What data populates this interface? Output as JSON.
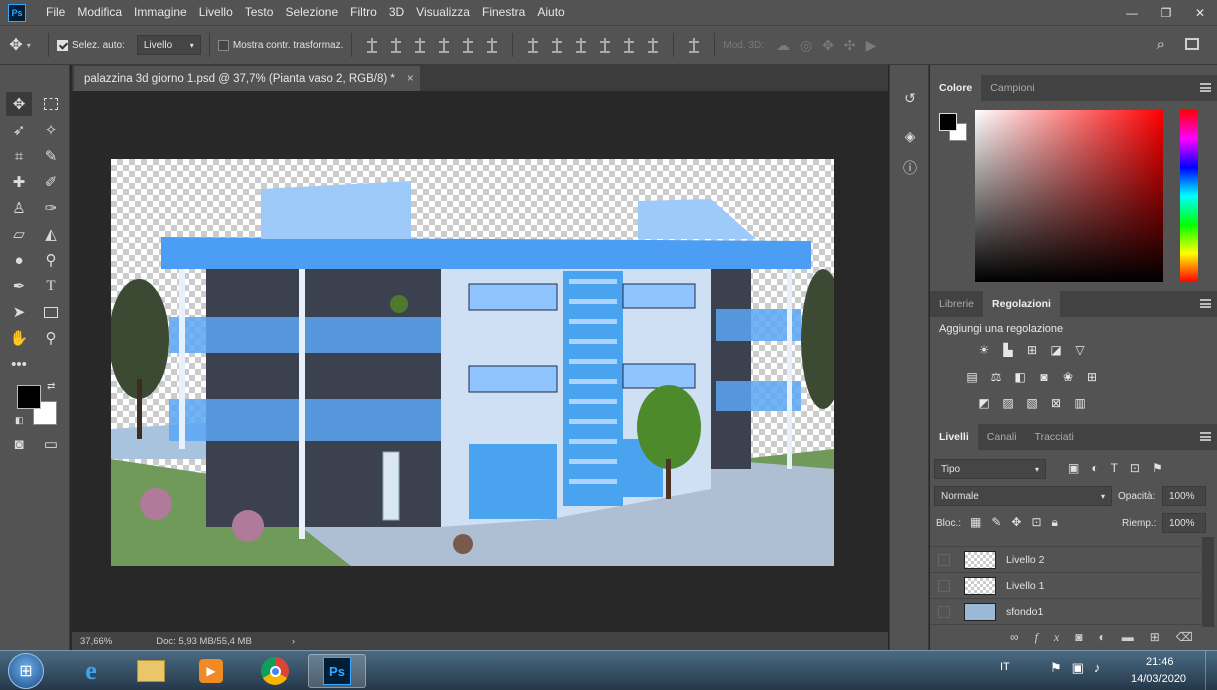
{
  "app": {
    "logo_text": "Ps",
    "menu": [
      "File",
      "Modifica",
      "Immagine",
      "Livello",
      "Testo",
      "Selezione",
      "Filtro",
      "3D",
      "Visualizza",
      "Finestra",
      "Aiuto"
    ]
  },
  "window_controls": {
    "minimize": "—",
    "restore": "❐",
    "close": "✕"
  },
  "options_bar": {
    "auto_select_label": "Selez. auto:",
    "auto_select_checked": true,
    "auto_select_value": "Livello",
    "show_transform_label": "Mostra contr. trasformaz.",
    "show_transform_checked": false,
    "mode_3d_label": "Mod. 3D:"
  },
  "document": {
    "tab_title": "palazzina 3d giorno 1.psd @ 37,7% (Pianta vaso 2, RGB/8) *",
    "close_glyph": "×",
    "zoom": "37,66%",
    "doc_size": "Doc: 5,93 MB/55,4 MB",
    "status_arrow": "›"
  },
  "panels": {
    "color": {
      "tabs": [
        "Colore",
        "Campioni"
      ],
      "active_tab": "Colore",
      "hue": "#ff0000"
    },
    "adjustments": {
      "tabs": [
        "Librerie",
        "Regolazioni"
      ],
      "active_tab": "Regolazioni",
      "heading": "Aggiungi una regolazione"
    },
    "layers": {
      "tabs": [
        "Livelli",
        "Canali",
        "Tracciati"
      ],
      "active_tab": "Livelli",
      "filter_label": "Tipo",
      "blend_mode": "Normale",
      "opacity_label": "Opacità:",
      "opacity_value": "100%",
      "lock_label": "Bloc.:",
      "fill_label": "Riemp.:",
      "fill_value": "100%",
      "items": [
        {
          "name": "Livello 2"
        },
        {
          "name": "Livello 1"
        },
        {
          "name": "sfondo1"
        }
      ]
    }
  },
  "taskbar": {
    "language": "IT",
    "time": "21:46",
    "date": "14/03/2020",
    "apps": [
      "start-orb",
      "internet-explorer",
      "file-explorer",
      "media-player",
      "chrome",
      "photoshop"
    ],
    "active_app": "photoshop"
  },
  "colors": {
    "accent": "#31a8ff",
    "foreground": "#000000",
    "background": "#ffffff"
  }
}
